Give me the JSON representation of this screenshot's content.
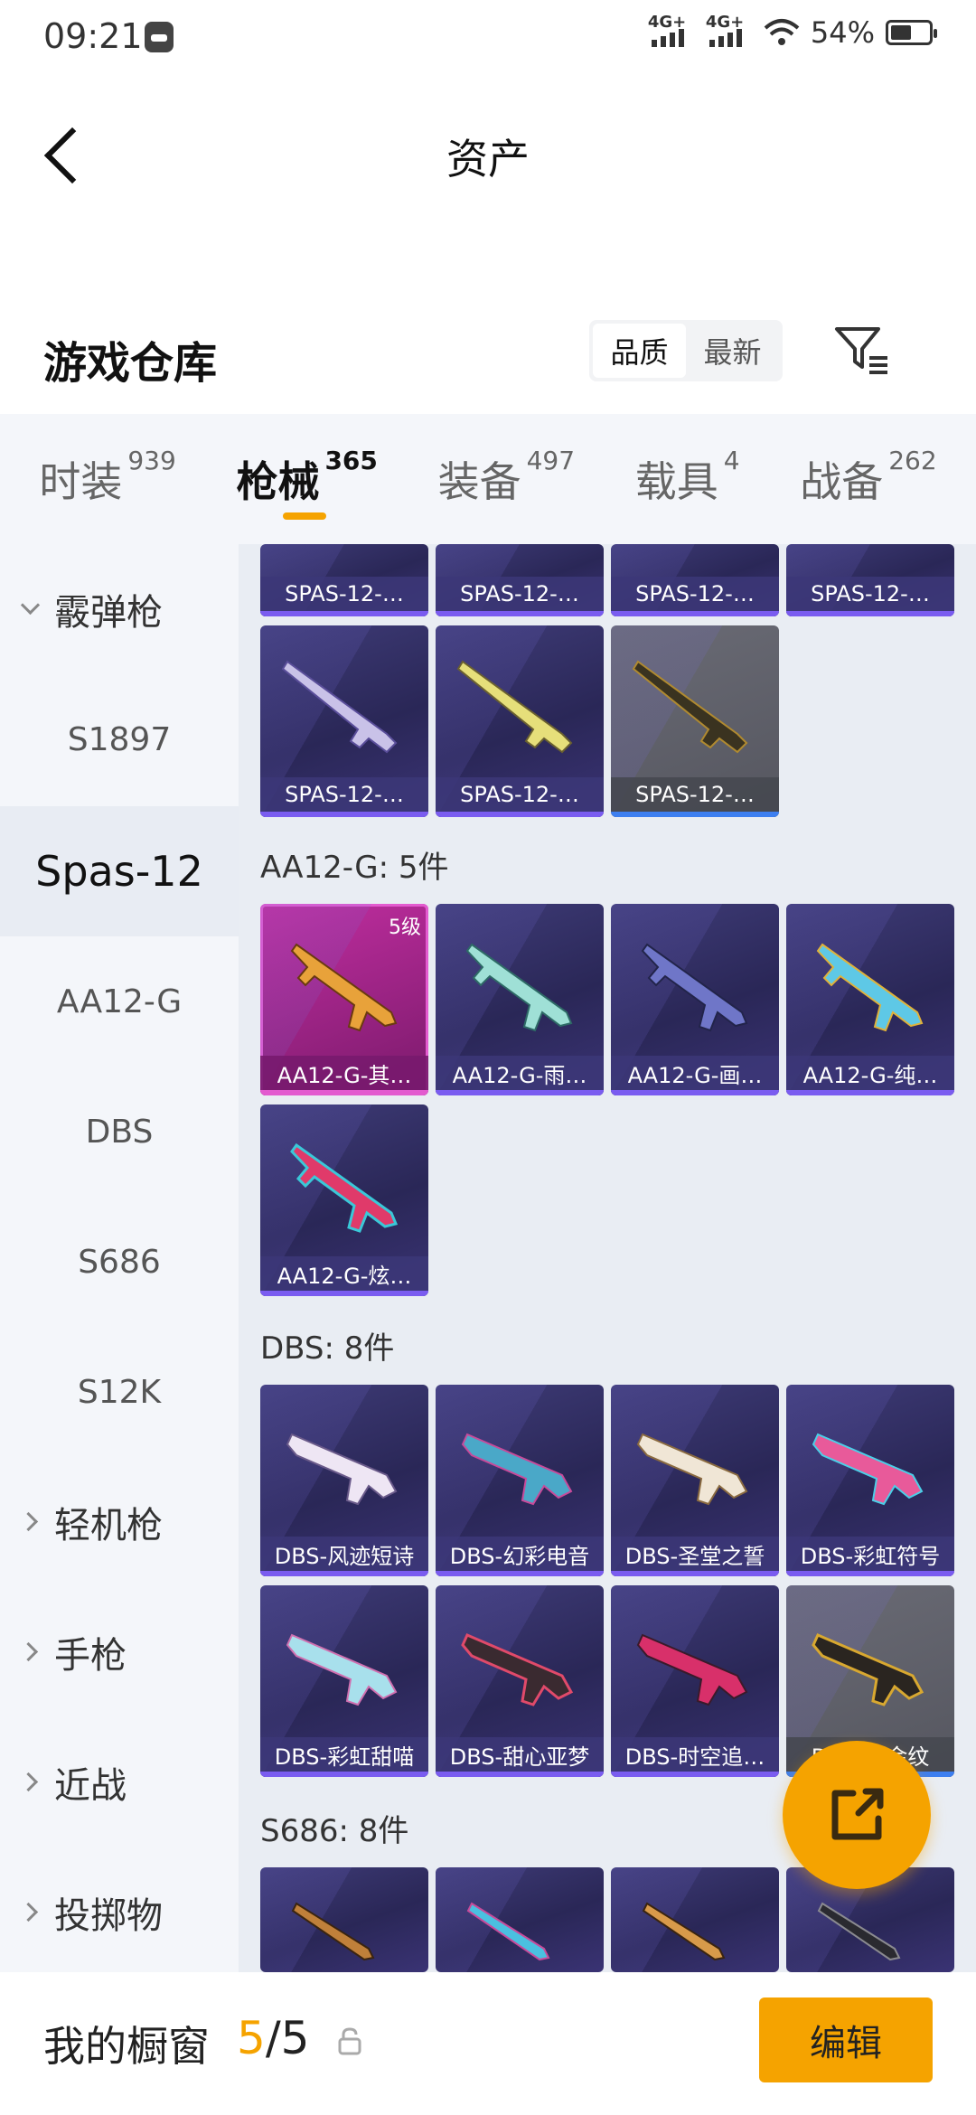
{
  "status_bar": {
    "time": "09:21",
    "network1": "4G+",
    "network2": "4G+",
    "battery": "54%"
  },
  "header": {
    "title": "资产"
  },
  "section": {
    "title": "游戏仓库",
    "sort_options": [
      "品质",
      "最新"
    ]
  },
  "tabs": [
    {
      "label": "时装",
      "count": "939"
    },
    {
      "label": "枪械",
      "count": "365"
    },
    {
      "label": "装备",
      "count": "497"
    },
    {
      "label": "载具",
      "count": "4"
    },
    {
      "label": "战备",
      "count": "262"
    }
  ],
  "sidebar": {
    "shotgun_group": "霰弹枪",
    "items": [
      "S1897",
      "Spas-12",
      "AA12-G",
      "DBS",
      "S686",
      "S12K"
    ],
    "groups": [
      "轻机枪",
      "手枪",
      "近战",
      "投掷物"
    ]
  },
  "content": {
    "spas_top_row": [
      "SPAS-12-…",
      "SPAS-12-…",
      "SPAS-12-…",
      "SPAS-12-…"
    ],
    "spas_row2": [
      "SPAS-12-…",
      "SPAS-12-…",
      "SPAS-12-…"
    ],
    "aa12_header": "AA12-G: 5件",
    "aa12_row1": [
      "AA12-G-其…",
      "AA12-G-雨…",
      "AA12-G-画…",
      "AA12-G-纯…"
    ],
    "aa12_badge": "5级",
    "aa12_row2": [
      "AA12-G-炫…"
    ],
    "dbs_header": "DBS: 8件",
    "dbs_row1": [
      "DBS-风迹短诗",
      "DBS-幻彩电音",
      "DBS-圣堂之誓",
      "DBS-彩虹符号"
    ],
    "dbs_row2": [
      "DBS-彩虹甜喵",
      "DBS-甜心亚梦",
      "DBS-时空追…",
      "DBS-暗金纹"
    ],
    "s686_header": "S686: 8件"
  },
  "bottom_bar": {
    "label": "我的橱窗",
    "current": "5",
    "sep_total": "/5",
    "edit_label": "编辑"
  },
  "colors": {
    "accent": "#f5a300",
    "card_bg": "#2a2757",
    "card_border": "#7a5cf0"
  }
}
